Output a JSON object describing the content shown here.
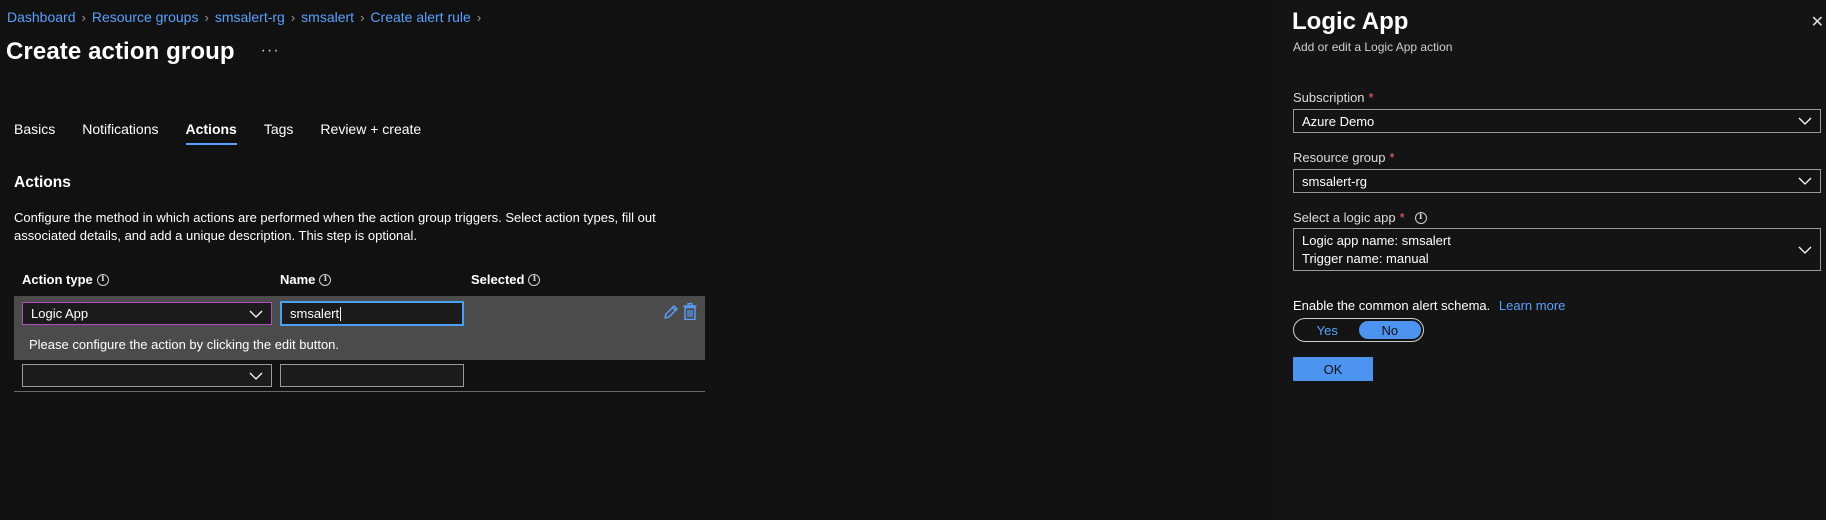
{
  "breadcrumb": [
    "Dashboard",
    "Resource groups",
    "smsalert-rg",
    "smsalert",
    "Create alert rule"
  ],
  "page": {
    "title": "Create action group",
    "more": "···"
  },
  "tabs": [
    {
      "label": "Basics",
      "active": false
    },
    {
      "label": "Notifications",
      "active": false
    },
    {
      "label": "Actions",
      "active": true
    },
    {
      "label": "Tags",
      "active": false
    },
    {
      "label": "Review + create",
      "active": false
    }
  ],
  "actions": {
    "title": "Actions",
    "description": "Configure the method in which actions are performed when the action group triggers. Select action types, fill out associated details, and add a unique description. This step is optional.",
    "columns": {
      "action_type": "Action type",
      "name": "Name",
      "selected": "Selected"
    },
    "row1": {
      "action_type": "Logic App",
      "name": "smsalert",
      "note": "Please configure the action by clicking the edit button."
    },
    "row2": {
      "action_type": "",
      "name": ""
    }
  },
  "blade": {
    "title": "Logic App",
    "subtitle": "Add or edit a Logic App action",
    "subscription": {
      "label": "Subscription",
      "value": "Azure Demo"
    },
    "resource_group": {
      "label": "Resource group",
      "value": "smsalert-rg"
    },
    "logic_app": {
      "label": "Select a logic app",
      "line1": "Logic app name: smsalert",
      "line2": "Trigger name: manual"
    },
    "schema": {
      "label": "Enable the common alert schema.",
      "link": "Learn more",
      "yes": "Yes",
      "no": "No",
      "selected": "No"
    },
    "ok": "OK",
    "required_mark": "*"
  },
  "colors": {
    "accent": "#4d93f0",
    "link": "#5aa0ff",
    "required": "#ff6a6a",
    "focus_purple": "#b14fbf"
  }
}
